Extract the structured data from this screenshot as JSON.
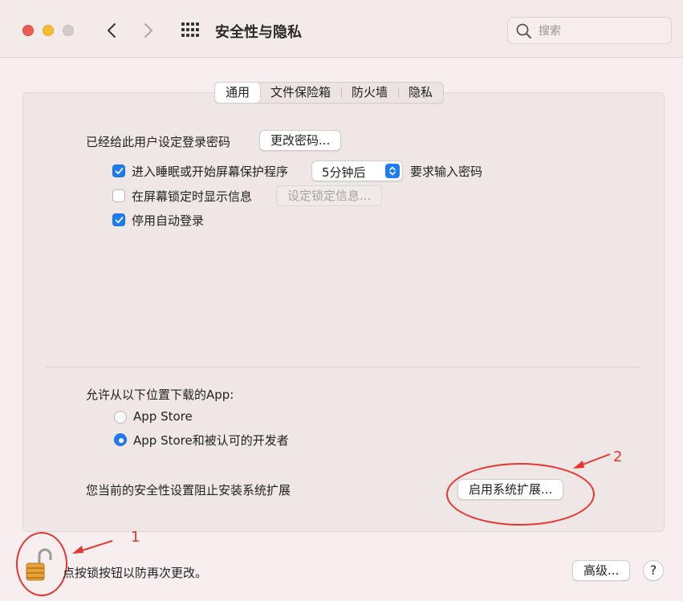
{
  "window": {
    "title": "安全性与隐私",
    "search_placeholder": "搜索"
  },
  "tabs": [
    {
      "label": "通用",
      "active": true
    },
    {
      "label": "文件保险箱",
      "active": false
    },
    {
      "label": "防火墙",
      "active": false
    },
    {
      "label": "隐私",
      "active": false
    }
  ],
  "general": {
    "password_set_label": "已经给此用户设定登录密码",
    "change_password_button": "更改密码...",
    "require_password_checkbox": {
      "label": "进入睡眠或开始屏幕保护程序",
      "checked": true
    },
    "require_password_delay": "5分钟后",
    "require_password_suffix": "要求输入密码",
    "show_message_checkbox": {
      "label": "在屏幕锁定时显示信息",
      "checked": false
    },
    "set_lock_message_button": "设定锁定信息...",
    "disable_autologin_checkbox": {
      "label": "停用自动登录",
      "checked": true
    }
  },
  "downloads": {
    "heading": "允许从以下位置下载的App:",
    "options": [
      {
        "label": "App Store",
        "selected": false
      },
      {
        "label": "App Store和被认可的开发者",
        "selected": true
      }
    ]
  },
  "extensions": {
    "message": "您当前的安全性设置阻止安装系统扩展",
    "enable_button": "启用系统扩展..."
  },
  "footer": {
    "lock_hint": "点按锁按钮以防再次更改。",
    "advanced_button": "高级...",
    "help_button": "?"
  },
  "annotations": {
    "label_1": "1",
    "label_2": "2"
  },
  "colors": {
    "accent": "#1d7cf2",
    "annotation": "#e6352f"
  }
}
